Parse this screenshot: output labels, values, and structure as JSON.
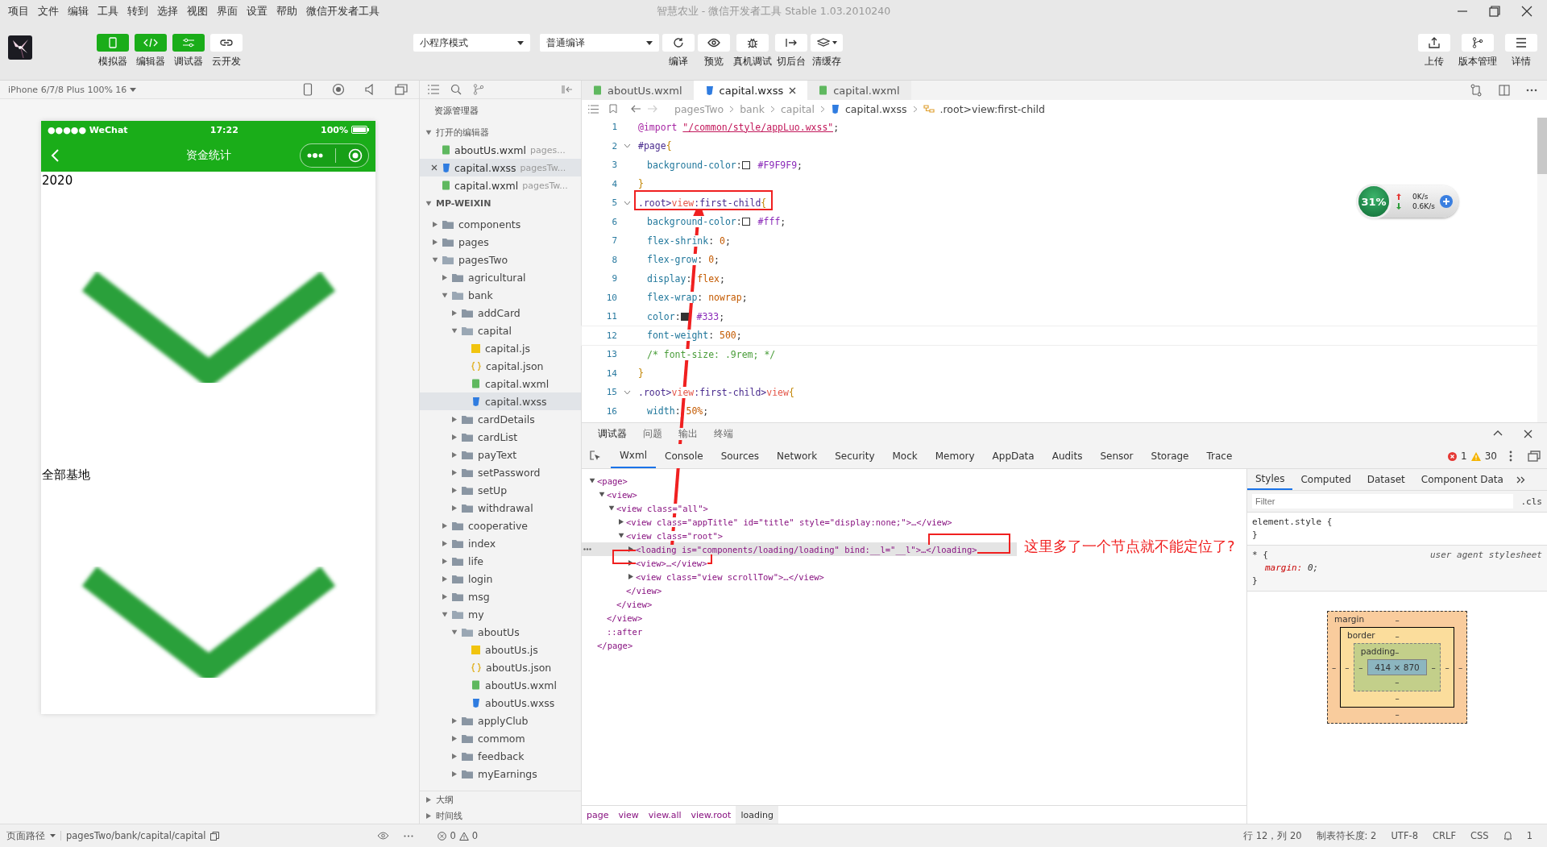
{
  "window": {
    "title": "智慧农业 - 微信开发者工具 Stable 1.03.2010240"
  },
  "menu": [
    "项目",
    "文件",
    "编辑",
    "工具",
    "转到",
    "选择",
    "视图",
    "界面",
    "设置",
    "帮助",
    "微信开发者工具"
  ],
  "toolbar": {
    "panel_toggles": [
      {
        "label": "模拟器",
        "kind": "phone",
        "on": true
      },
      {
        "label": "编辑器",
        "kind": "code",
        "on": true
      },
      {
        "label": "调试器",
        "kind": "sliders",
        "on": true
      }
    ],
    "cloud_button": "云开发",
    "mode_select": "小程序模式",
    "compile_select": "普通编译",
    "actions": [
      {
        "label": "编译",
        "kind": "refresh"
      },
      {
        "label": "预览",
        "kind": "eye"
      },
      {
        "label": "真机调试",
        "kind": "bug"
      },
      {
        "label": "切后台",
        "kind": "switch"
      },
      {
        "label": "清缓存",
        "kind": "layers"
      }
    ],
    "right_actions": [
      {
        "label": "上传",
        "kind": "upload"
      },
      {
        "label": "版本管理",
        "kind": "branch"
      },
      {
        "label": "详情",
        "kind": "menu"
      }
    ]
  },
  "simulator": {
    "device": "iPhone 6/7/8 Plus 100% 16",
    "phone": {
      "carrier": "●●●●● WeChat",
      "time": "17:22",
      "battery": "100%",
      "title": "资金统计",
      "content": [
        {
          "kind": "text",
          "text": "2020"
        },
        {
          "kind": "check"
        },
        {
          "kind": "text",
          "text": "全部基地"
        },
        {
          "kind": "check"
        }
      ]
    }
  },
  "explorer": {
    "title": "资源管理器",
    "open_editors": {
      "label": "打开的编辑器",
      "expanded": true,
      "items": [
        {
          "name": "aboutUs.wxml",
          "path": "pages...",
          "kind": "wxml",
          "selected": false
        },
        {
          "name": "capital.wxss",
          "path": "pagesTw...",
          "kind": "wxss",
          "selected": true
        },
        {
          "name": "capital.wxml",
          "path": "pagesTw...",
          "kind": "wxml",
          "selected": false
        }
      ]
    },
    "project": {
      "label": "MP-WEIXIN",
      "expanded": true,
      "tree": [
        {
          "name": "components",
          "kind": "folder",
          "expanded": false,
          "selected": false
        },
        {
          "name": "pages",
          "kind": "folder",
          "expanded": false,
          "selected": false
        },
        {
          "name": "pagesTwo",
          "kind": "folder",
          "expanded": true,
          "selected": false,
          "children": [
            {
              "name": "agricultural",
              "kind": "folder",
              "expanded": false,
              "selected": false
            },
            {
              "name": "bank",
              "kind": "folder",
              "expanded": true,
              "selected": false,
              "children": [
                {
                  "name": "addCard",
                  "kind": "folder",
                  "expanded": false,
                  "selected": false
                },
                {
                  "name": "capital",
                  "kind": "folder",
                  "expanded": true,
                  "selected": false,
                  "children": [
                    {
                      "name": "capital.js",
                      "kind": "js",
                      "selected": false
                    },
                    {
                      "name": "capital.json",
                      "kind": "json",
                      "selected": false
                    },
                    {
                      "name": "capital.wxml",
                      "kind": "wxml",
                      "selected": false
                    },
                    {
                      "name": "capital.wxss",
                      "kind": "wxss",
                      "selected": true
                    }
                  ]
                },
                {
                  "name": "cardDetails",
                  "kind": "folder",
                  "expanded": false,
                  "selected": false
                },
                {
                  "name": "cardList",
                  "kind": "folder",
                  "expanded": false,
                  "selected": false
                },
                {
                  "name": "payText",
                  "kind": "folder",
                  "expanded": false,
                  "selected": false
                },
                {
                  "name": "setPassword",
                  "kind": "folder",
                  "expanded": false,
                  "selected": false
                },
                {
                  "name": "setUp",
                  "kind": "folder",
                  "expanded": false,
                  "selected": false
                },
                {
                  "name": "withdrawal",
                  "kind": "folder",
                  "expanded": false,
                  "selected": false
                }
              ]
            },
            {
              "name": "cooperative",
              "kind": "folder",
              "expanded": false,
              "selected": false
            },
            {
              "name": "index",
              "kind": "folder",
              "expanded": false,
              "selected": false
            },
            {
              "name": "life",
              "kind": "folder",
              "expanded": false,
              "selected": false
            },
            {
              "name": "login",
              "kind": "folder",
              "expanded": false,
              "selected": false
            },
            {
              "name": "msg",
              "kind": "folder",
              "expanded": false,
              "selected": false
            },
            {
              "name": "my",
              "kind": "folder",
              "expanded": true,
              "selected": false,
              "children": [
                {
                  "name": "aboutUs",
                  "kind": "folder",
                  "expanded": true,
                  "selected": false,
                  "children": [
                    {
                      "name": "aboutUs.js",
                      "kind": "js",
                      "selected": false
                    },
                    {
                      "name": "aboutUs.json",
                      "kind": "json",
                      "selected": false
                    },
                    {
                      "name": "aboutUs.wxml",
                      "kind": "wxml",
                      "selected": false
                    },
                    {
                      "name": "aboutUs.wxss",
                      "kind": "wxss",
                      "selected": false
                    }
                  ]
                },
                {
                  "name": "applyClub",
                  "kind": "folder",
                  "expanded": false,
                  "selected": false
                },
                {
                  "name": "commom",
                  "kind": "folder",
                  "expanded": false,
                  "selected": false
                },
                {
                  "name": "feedback",
                  "kind": "folder",
                  "expanded": false,
                  "selected": false
                },
                {
                  "name": "myEarnings",
                  "kind": "folder",
                  "expanded": false,
                  "selected": false
                }
              ]
            }
          ]
        }
      ]
    },
    "bottom_sections": [
      {
        "label": "大纲",
        "expanded": false
      },
      {
        "label": "时间线",
        "expanded": false
      }
    ]
  },
  "editor": {
    "tabs": [
      {
        "name": "aboutUs.wxml",
        "kind": "wxml",
        "selected": false
      },
      {
        "name": "capital.wxss",
        "kind": "wxss",
        "selected": true
      },
      {
        "name": "capital.wxml",
        "kind": "wxml",
        "selected": false
      }
    ],
    "breadcrumb": [
      "pagesTwo",
      "bank",
      "capital",
      "capital.wxss",
      ".root>view:first-child"
    ],
    "lines": [
      {
        "number": "1",
        "current": false,
        "segments": [
          {
            "kind": "at",
            "text": "@import"
          },
          {
            "kind": "string",
            "text": "\"/common/style/appLuo.wxss\""
          },
          {
            "kind": "plain",
            "text": ";"
          }
        ]
      },
      {
        "number": "2",
        "current": false,
        "foldable": true,
        "segments": [
          {
            "kind": "selector",
            "text": "#page"
          },
          {
            "kind": "brace",
            "text": "{"
          }
        ]
      },
      {
        "number": "3",
        "current": false,
        "segments": [
          {
            "kind": "prop",
            "text": "background-color"
          },
          {
            "kind": "plain",
            "text": ":"
          },
          {
            "kind": "color",
            "text": "#F9F9F9"
          },
          {
            "kind": "plain",
            "text": ";"
          }
        ]
      },
      {
        "number": "4",
        "current": false,
        "segments": [
          {
            "kind": "brace",
            "text": "}"
          }
        ]
      },
      {
        "number": "5",
        "current": false,
        "foldable": true,
        "segments": [
          {
            "kind": "selector",
            "text": ".root>"
          },
          {
            "kind": "tag",
            "text": "view"
          },
          {
            "kind": "selector",
            "text": ":first-child"
          },
          {
            "kind": "brace",
            "text": "{"
          }
        ]
      },
      {
        "number": "6",
        "current": false,
        "segments": [
          {
            "kind": "prop",
            "text": "background-color"
          },
          {
            "kind": "plain",
            "text": ":"
          },
          {
            "kind": "color",
            "text": "#fff"
          },
          {
            "kind": "plain",
            "text": ";"
          }
        ]
      },
      {
        "number": "7",
        "current": false,
        "segments": [
          {
            "kind": "prop",
            "text": "flex-shrink"
          },
          {
            "kind": "plain",
            "text": ":"
          },
          {
            "kind": "value",
            "text": "0"
          },
          {
            "kind": "plain",
            "text": ";"
          }
        ]
      },
      {
        "number": "8",
        "current": false,
        "segments": [
          {
            "kind": "prop",
            "text": "flex-grow"
          },
          {
            "kind": "plain",
            "text": ":"
          },
          {
            "kind": "value",
            "text": "0"
          },
          {
            "kind": "plain",
            "text": ";"
          }
        ]
      },
      {
        "number": "9",
        "current": false,
        "segments": [
          {
            "kind": "prop",
            "text": "display"
          },
          {
            "kind": "plain",
            "text": ":"
          },
          {
            "kind": "value",
            "text": "flex"
          },
          {
            "kind": "plain",
            "text": ";"
          }
        ]
      },
      {
        "number": "10",
        "current": false,
        "segments": [
          {
            "kind": "prop",
            "text": "flex-wrap"
          },
          {
            "kind": "plain",
            "text": ":"
          },
          {
            "kind": "value",
            "text": "nowrap"
          },
          {
            "kind": "plain",
            "text": ";"
          }
        ]
      },
      {
        "number": "11",
        "current": false,
        "segments": [
          {
            "kind": "prop",
            "text": "color"
          },
          {
            "kind": "plain",
            "text": ":"
          },
          {
            "kind": "color",
            "text": "#333"
          },
          {
            "kind": "plain",
            "text": ";"
          }
        ]
      },
      {
        "number": "12",
        "current": true,
        "segments": [
          {
            "kind": "prop",
            "text": "font-weight"
          },
          {
            "kind": "plain",
            "text": ":"
          },
          {
            "kind": "value",
            "text": "500"
          },
          {
            "kind": "plain",
            "text": ";"
          }
        ]
      },
      {
        "number": "13",
        "current": false,
        "segments": [
          {
            "kind": "comment",
            "text": "/* font-size: .9rem; */"
          }
        ]
      },
      {
        "number": "14",
        "current": false,
        "segments": [
          {
            "kind": "brace",
            "text": "}"
          }
        ]
      },
      {
        "number": "15",
        "current": false,
        "foldable": true,
        "segments": [
          {
            "kind": "selector",
            "text": ".root>"
          },
          {
            "kind": "tag",
            "text": "view"
          },
          {
            "kind": "selector",
            "text": ":first-child>"
          },
          {
            "kind": "tag",
            "text": "view"
          },
          {
            "kind": "brace",
            "text": "{"
          }
        ]
      },
      {
        "number": "16",
        "current": false,
        "segments": [
          {
            "kind": "prop",
            "text": "width"
          },
          {
            "kind": "plain",
            "text": ":"
          },
          {
            "kind": "value",
            "text": "50%"
          },
          {
            "kind": "plain",
            "text": ";"
          }
        ]
      }
    ]
  },
  "net_widget": {
    "percent": "31%",
    "upload": "0K/s",
    "download": "0.6K/s"
  },
  "devtools": {
    "panel_tabs": [
      {
        "label": "调试器",
        "selected": true
      },
      {
        "label": "问题",
        "selected": false
      },
      {
        "label": "输出",
        "selected": false
      },
      {
        "label": "终端",
        "selected": false
      }
    ],
    "tabs": [
      {
        "label": "Wxml",
        "selected": true
      },
      {
        "label": "Console",
        "selected": false
      },
      {
        "label": "Sources",
        "selected": false
      },
      {
        "label": "Network",
        "selected": false
      },
      {
        "label": "Security",
        "selected": false
      },
      {
        "label": "Mock",
        "selected": false
      },
      {
        "label": "Memory",
        "selected": false
      },
      {
        "label": "AppData",
        "selected": false
      },
      {
        "label": "Audits",
        "selected": false
      },
      {
        "label": "Sensor",
        "selected": false
      },
      {
        "label": "Storage",
        "selected": false
      },
      {
        "label": "Trace",
        "selected": false
      }
    ],
    "errors": "1",
    "warnings": "30",
    "wxml": [
      {
        "kind": "element",
        "open": "<page>",
        "close": "</page>",
        "expanded": true,
        "selected": false,
        "children": [
          {
            "kind": "element",
            "open": "<view>",
            "close": "</view>",
            "expanded": true,
            "selected": false,
            "children": [
              {
                "kind": "element",
                "open": "<view class=\"all\">",
                "close": "</view>",
                "expanded": true,
                "selected": false,
                "children": [
                  {
                    "kind": "element",
                    "open": "<view class=\"appTitle\" id=\"title\" style=\"display:none;\">…</view>",
                    "expanded": false,
                    "selected": false
                  },
                  {
                    "kind": "element",
                    "open": "<view class=\"root\">",
                    "close": "</view>",
                    "expanded": true,
                    "selected": false,
                    "children": [
                      {
                        "kind": "element",
                        "open": "<loading is=\"components/loading/loading\" bind:__l=\"__l\">…</loading>",
                        "expanded": false,
                        "selected": true
                      },
                      {
                        "kind": "element",
                        "open": "<view>…</view>",
                        "expanded": false,
                        "selected": false
                      },
                      {
                        "kind": "element",
                        "open": "<view class=\"view scrollTow\">…</view>",
                        "expanded": false,
                        "selected": false
                      }
                    ]
                  }
                ]
              }
            ]
          },
          {
            "kind": "pseudo",
            "open": "::after",
            "selected": false
          }
        ]
      }
    ],
    "breadcrumb": [
      {
        "label": "page",
        "selected": false
      },
      {
        "label": "view",
        "selected": false
      },
      {
        "label": "view.all",
        "selected": false
      },
      {
        "label": "view.root",
        "selected": false
      },
      {
        "label": "loading",
        "selected": true
      }
    ],
    "styles": {
      "tabs": [
        {
          "label": "Styles",
          "selected": true
        },
        {
          "label": "Computed",
          "selected": false
        },
        {
          "label": "Dataset",
          "selected": false
        },
        {
          "label": "Component Data",
          "selected": false
        }
      ],
      "filter_placeholder": "Filter",
      "cls": ".cls",
      "rules": [
        {
          "selector": "element.style {",
          "close": "}"
        },
        {
          "selector": "* {",
          "source": "user agent stylesheet",
          "declarations": [
            {
              "property": "margin:",
              "value": "0;"
            }
          ],
          "close": "}"
        }
      ],
      "box_model": {
        "margin_label": "margin",
        "margin_top": "–",
        "border_label": "border",
        "border_top": "–",
        "padding_label": "padding",
        "padding_top": "–",
        "middle": [
          "–",
          "–",
          "–",
          "414 × 870",
          "–",
          "–",
          "–"
        ],
        "padding_bottom": "–",
        "border_bottom": "–",
        "margin_bottom": "–"
      }
    }
  },
  "annotation": {
    "note": "这里多了一个节点就不能定位了?"
  },
  "status_bar": {
    "page_path_label": "页面路径",
    "page_path": "pagesTwo/bank/capital/capital",
    "errors": "0",
    "warnings": "0",
    "cursor": "行 12，列 20",
    "tab_size": "制表符长度: 2",
    "encoding": "UTF-8",
    "eol": "CRLF",
    "language": "CSS",
    "notifications": "1"
  }
}
